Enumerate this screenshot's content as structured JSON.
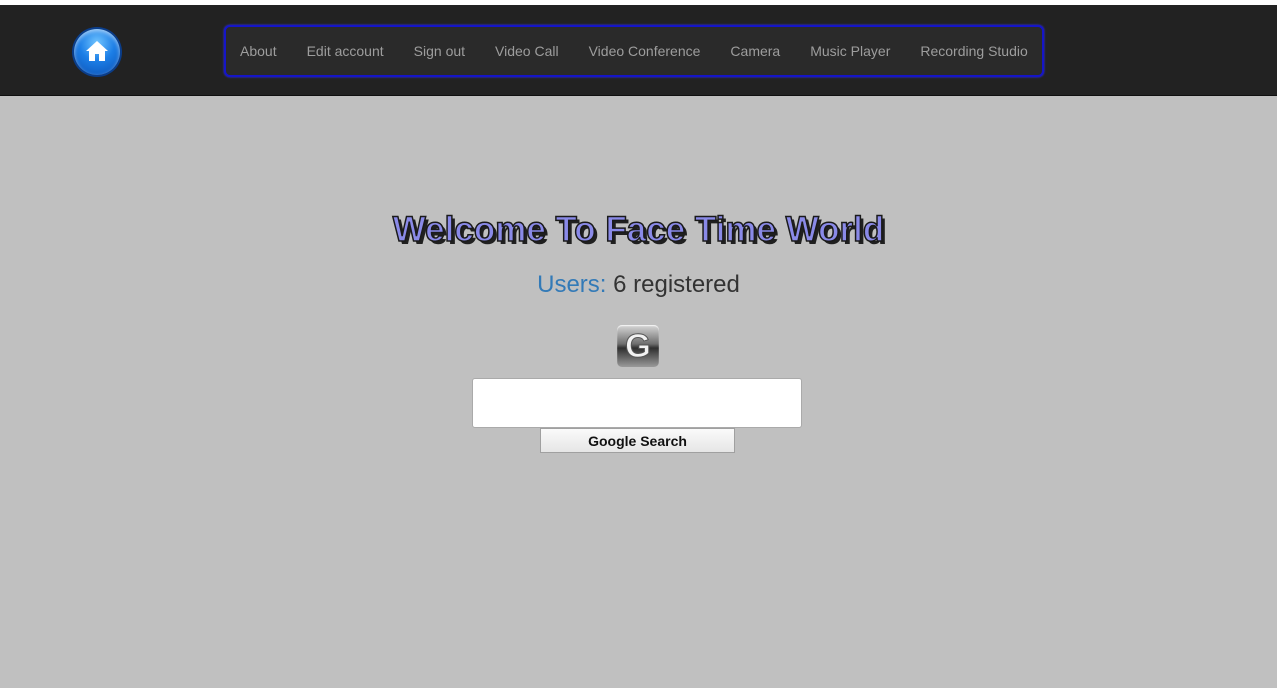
{
  "navbar": {
    "home_icon": "home-icon",
    "items": [
      {
        "label": "About"
      },
      {
        "label": "Edit account"
      },
      {
        "label": "Sign out"
      },
      {
        "label": "Video Call"
      },
      {
        "label": "Video Conference"
      },
      {
        "label": "Camera"
      },
      {
        "label": "Music Player"
      },
      {
        "label": "Recording Studio"
      }
    ]
  },
  "main": {
    "welcome_title": "Welcome To Face Time World",
    "users_label": "Users:",
    "users_value": "6 registered",
    "search_logo_letter": "G",
    "search_input": {
      "value": "",
      "placeholder": ""
    },
    "search_button_label": "Google Search"
  },
  "colors": {
    "navbar_bg": "#222222",
    "nav_border": "#1515c8",
    "page_bg": "#c0c0c0",
    "users_label": "#337ab7",
    "welcome_fill": "#8a8ae8"
  }
}
